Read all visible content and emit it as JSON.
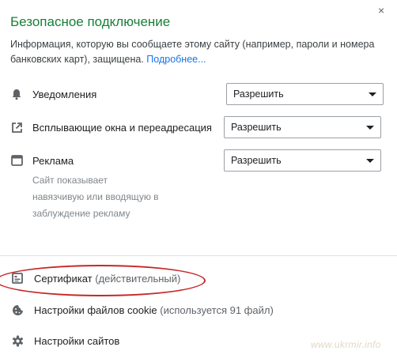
{
  "header": {
    "title": "Безопасное подключение",
    "close_glyph": "×"
  },
  "description": {
    "text": "Информация, которую вы сообщаете этому сайту (например, пароли и номера банковских карт), защищена.",
    "link": "Подробнее..."
  },
  "permissions": [
    {
      "icon": "bell-icon",
      "label": "Уведомления",
      "value": "Разрешить"
    },
    {
      "icon": "popup-redirect-icon",
      "label": "Всплывающие окна и переадресация",
      "value": "Разрешить"
    },
    {
      "icon": "ads-window-icon",
      "label": "Реклама",
      "value": "Разрешить",
      "description": "Сайт показывает навязчивую или вводящую в заблуждение рекламу"
    }
  ],
  "links": {
    "certificate": {
      "icon": "certificate-icon",
      "label": "Сертификат",
      "status": "(действительный)"
    },
    "cookies": {
      "icon": "cookie-icon",
      "label": "Настройки файлов cookie",
      "status": "(используется 91 файл)"
    },
    "site_settings": {
      "icon": "gear-icon",
      "label": "Настройки сайтов"
    }
  },
  "annotation": {
    "color": "#c62828"
  },
  "watermark": "www.ukrmir.info",
  "colors": {
    "secure_title": "#188038",
    "link": "#1a73e8",
    "icon": "#5f6368"
  }
}
